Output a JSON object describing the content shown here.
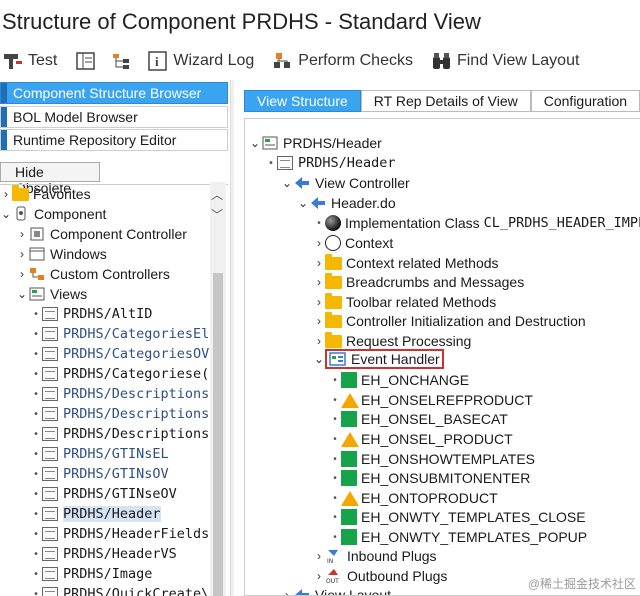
{
  "window": {
    "title": "Structure of Component PRDHS - Standard View"
  },
  "toolbar": {
    "test": "Test",
    "wizard_log": "Wizard Log",
    "perform_checks": "Perform Checks",
    "find_view_layout": "Find View Layout"
  },
  "left_nav": {
    "component_structure_browser": "Component Structure Browser",
    "bol_model_browser": "BOL Model Browser",
    "runtime_repository_editor": "Runtime Repository Editor",
    "hide_obsolete": "Hide Obsolete"
  },
  "left_tree": {
    "favorites": "Favorites",
    "component": "Component",
    "component_controller": "Component Controller",
    "windows": "Windows",
    "custom_controllers": "Custom Controllers",
    "views": "Views",
    "view_items": [
      "PRDHS/AltID",
      "PRDHS/CategoriesEl",
      "PRDHS/CategoriesOV",
      "PRDHS/Categoriese(",
      "PRDHS/Descriptions",
      "PRDHS/Descriptions",
      "PRDHS/Descriptions",
      "PRDHS/GTINsEL",
      "PRDHS/GTINsOV",
      "PRDHS/GTINseOV",
      "PRDHS/Header",
      "PRDHS/HeaderFields",
      "PRDHS/HeaderVS",
      "PRDHS/Image",
      "PRDHS/QuickCreate\\"
    ]
  },
  "tabs": [
    "View Structure",
    "RT Rep Details of View",
    "Configuration"
  ],
  "right_tree": {
    "root": "PRDHS/Header",
    "view": "PRDHS/Header",
    "view_controller": "View Controller",
    "header_do": "Header.do",
    "impl_class_label": "Implementation Class",
    "impl_class_value": "CL_PRDHS_HEADER_IMPL",
    "context": "Context",
    "context_methods": "Context related Methods",
    "breadcrumbs": "Breadcrumbs and Messages",
    "toolbar_methods": "Toolbar related Methods",
    "controller_init": "Controller Initialization and Destruction",
    "request_processing": "Request Processing",
    "event_handler": "Event Handler",
    "events": [
      {
        "name": "EH_ONCHANGE",
        "icon": "green-square"
      },
      {
        "name": "EH_ONSELREFPRODUCT",
        "icon": "warning-triangle"
      },
      {
        "name": "EH_ONSEL_BASECAT",
        "icon": "green-square"
      },
      {
        "name": "EH_ONSEL_PRODUCT",
        "icon": "warning-triangle"
      },
      {
        "name": "EH_ONSHOWTEMPLATES",
        "icon": "green-square"
      },
      {
        "name": "EH_ONSUBMITONENTER",
        "icon": "green-square"
      },
      {
        "name": "EH_ONTOPRODUCT",
        "icon": "warning-triangle"
      },
      {
        "name": "EH_ONWTY_TEMPLATES_CLOSE",
        "icon": "green-square"
      },
      {
        "name": "EH_ONWTY_TEMPLATES_POPUP",
        "icon": "green-square"
      }
    ],
    "inbound_plugs": "Inbound Plugs",
    "outbound_plugs": "Outbound Plugs",
    "view_layout": "View Layout"
  },
  "colors": {
    "accent": "#3aa4f0",
    "highlight_border": "#d0312d",
    "ok": "#16a34a",
    "warn": "#f5a700"
  },
  "watermark": "@稀土掘金技术社区"
}
